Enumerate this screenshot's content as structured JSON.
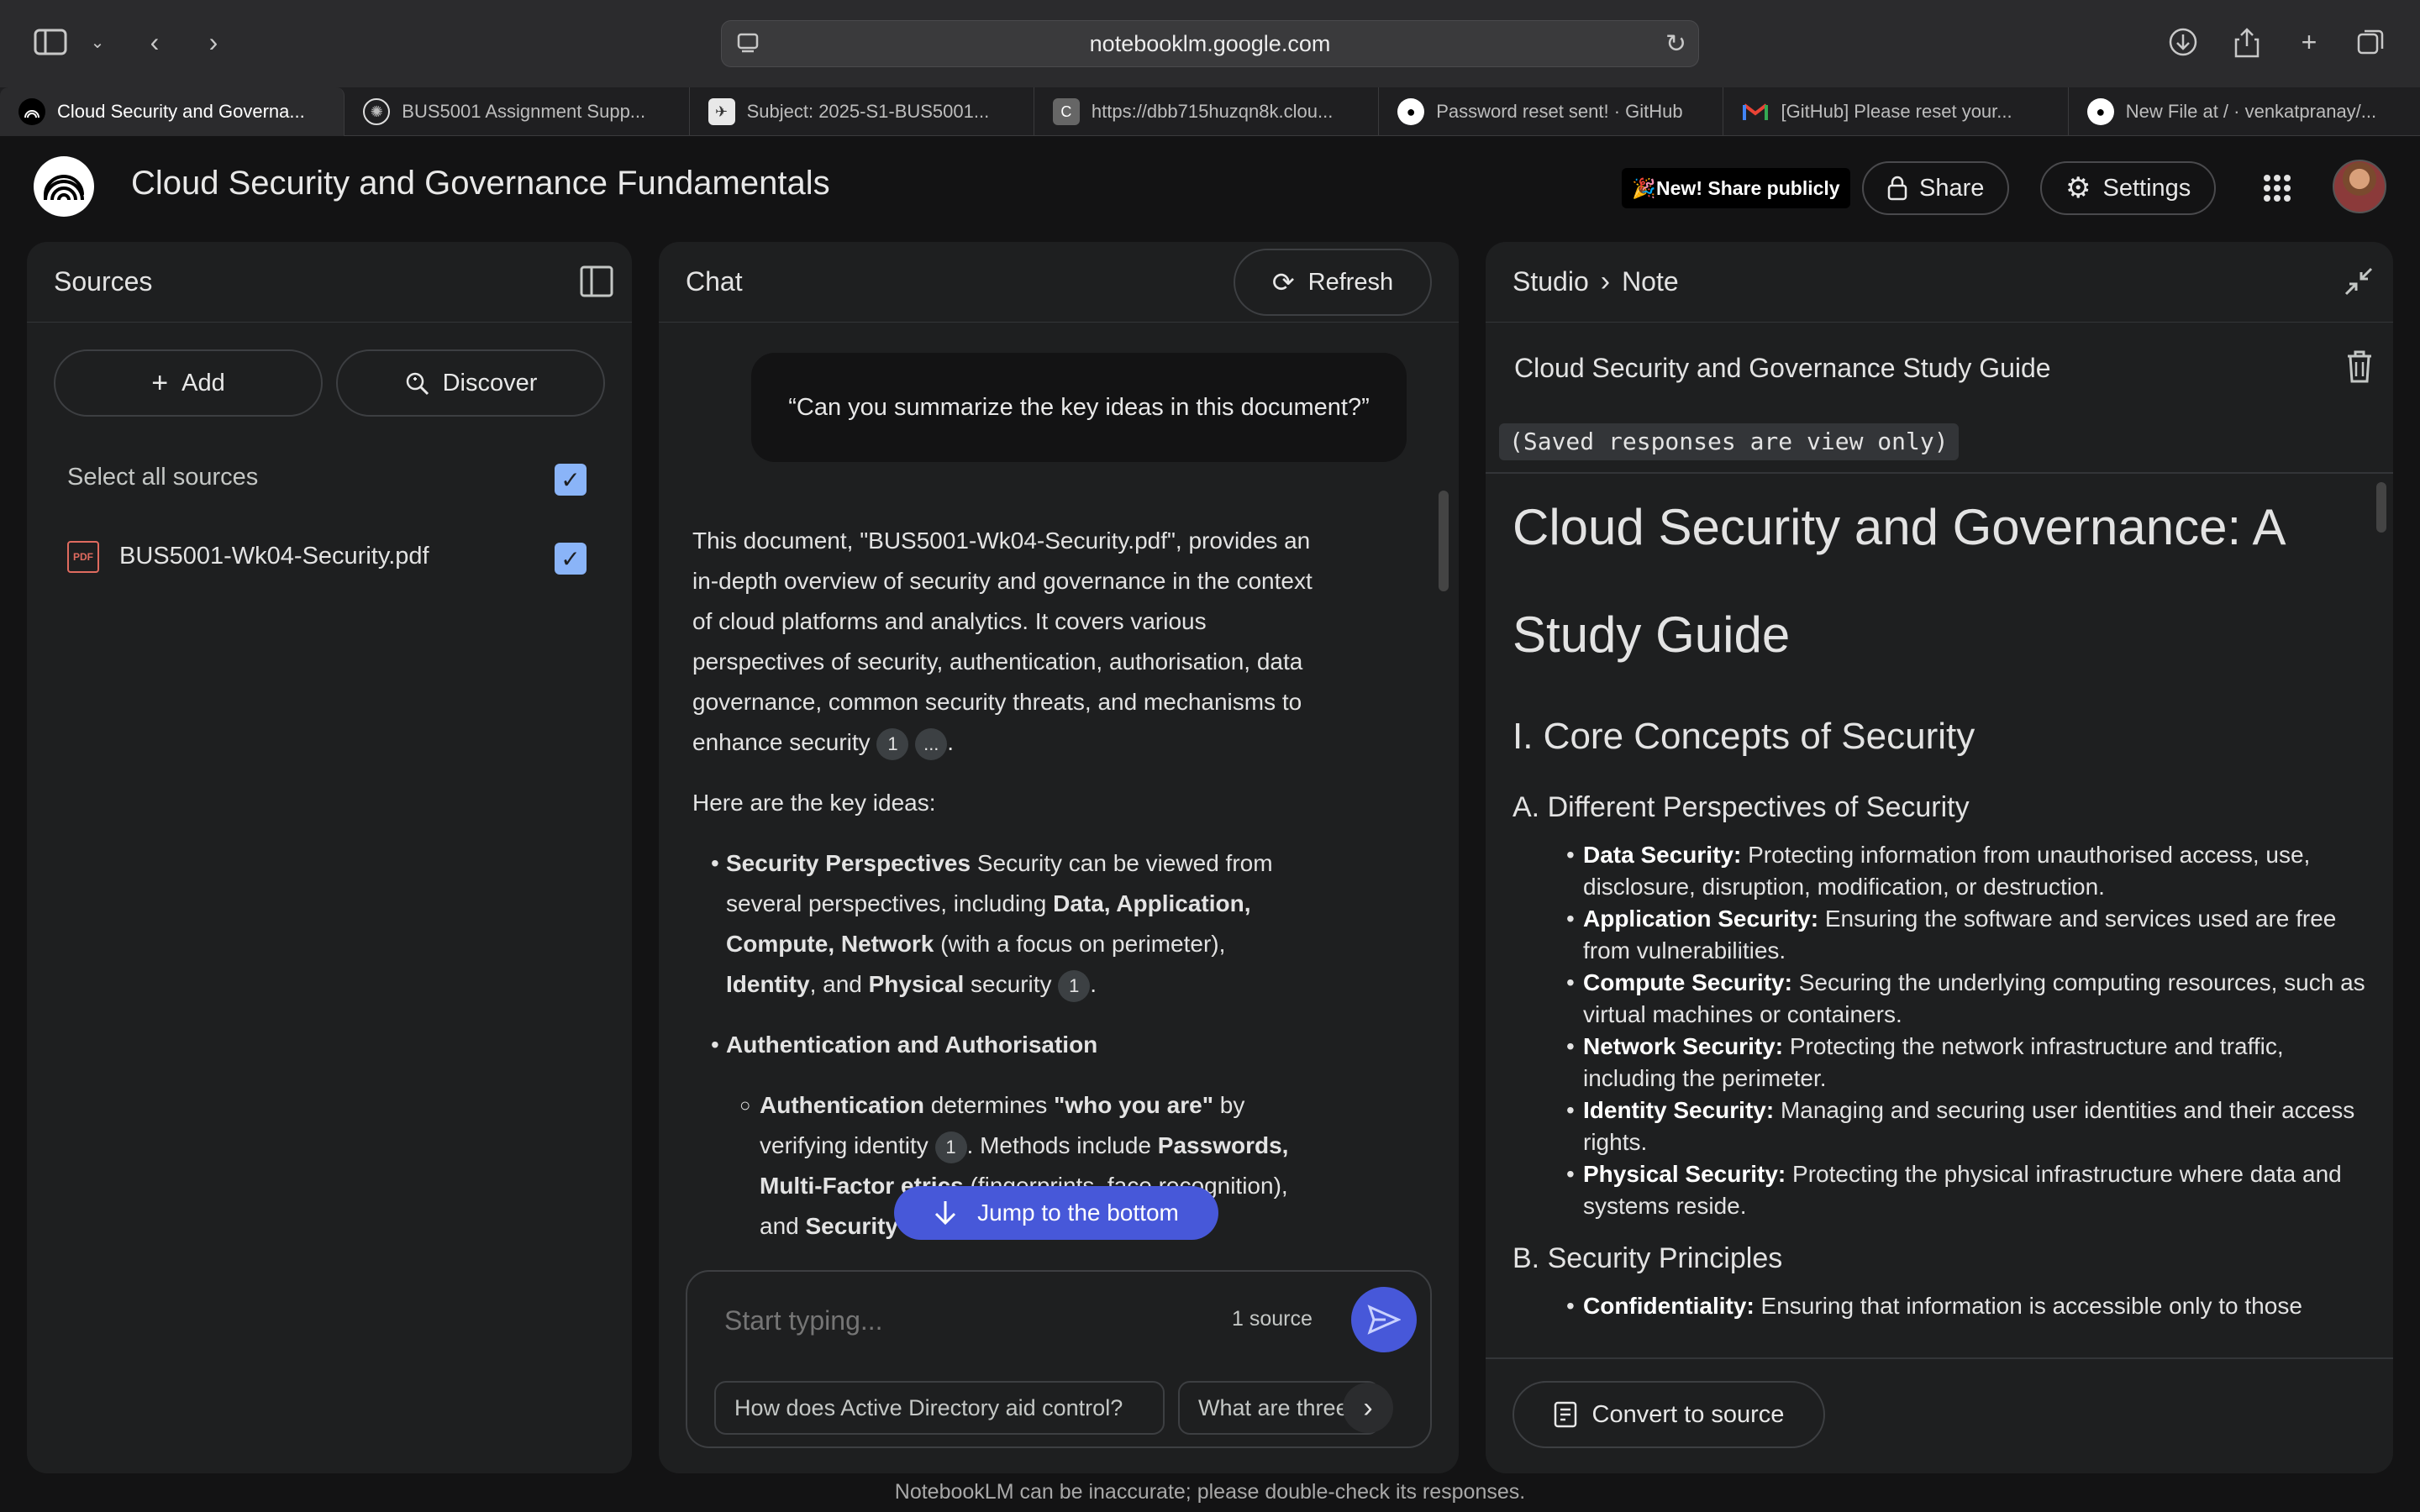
{
  "browser": {
    "url": "notebooklm.google.com",
    "tabs": [
      {
        "title": "Cloud Security and Governa...",
        "active": true,
        "fav": "notebooklm"
      },
      {
        "title": "BUS5001 Assignment Supp...",
        "fav": "chatgpt"
      },
      {
        "title": "Subject: 2025-S1-BUS5001...",
        "fav": "subject"
      },
      {
        "title": "https://dbb715huzqn8k.clou...",
        "fav": "c"
      },
      {
        "title": "Password reset sent! · GitHub",
        "fav": "github"
      },
      {
        "title": "[GitHub] Please reset your...",
        "fav": "gmail"
      },
      {
        "title": "New File at / · venkatpranay/...",
        "fav": "github"
      }
    ]
  },
  "header": {
    "notebook_title": "Cloud Security and Governance Fundamentals",
    "new_badge": "🎉New! Share publicly",
    "share_label": "Share",
    "settings_label": "Settings"
  },
  "sources": {
    "title": "Sources",
    "add_label": "Add",
    "discover_label": "Discover",
    "select_all_label": "Select all sources",
    "items": [
      {
        "name": "BUS5001-Wk04-Security.pdf",
        "checked": true
      }
    ]
  },
  "chat": {
    "title": "Chat",
    "refresh_label": "Refresh",
    "user_message": "“Can you summarize the key ideas in this document?”",
    "intro_parts": [
      "This document, \"BUS5001-Wk04-Security.pdf\", provides an in-depth overview of security and governance in the context of cloud platforms and analytics. It covers various perspectives of security, authentication, authorisation, data governance, common security threats, and mechanisms to enhance security",
      "1",
      "...",
      "."
    ],
    "key_ideas_label": "Here are the key ideas:",
    "bullet1": {
      "bold": "Security Perspectives",
      "text1": " Security can be viewed from several perspectives, including ",
      "bold2": "Data, Application, Compute, Network",
      "text2": " (with a focus on perimeter), ",
      "bold3": "Identity",
      "text3": ", and ",
      "bold4": "Physical",
      "text4": " security",
      "cite": "1",
      "end": "."
    },
    "bullet2_title": "Authentication and Authorisation",
    "sub1": {
      "bold": "Authentication",
      "text1": " determines ",
      "bold2": "\"who you are\"",
      "text2": " by verifying identity ",
      "cite": "1",
      "text3": ". Methods include ",
      "bold3": "Passwords, Multi-Factor",
      "text4": " ",
      "bold4": "etrics",
      "text5": " (fingerprints, face recognition), and ",
      "bold5": "Security"
    },
    "jump_label": "Jump to the bottom",
    "input_placeholder": "Start typing...",
    "source_count": "1 source",
    "suggestions": [
      "How does Active Directory aid control?",
      "What are three"
    ]
  },
  "studio": {
    "breadcrumb_root": "Studio",
    "breadcrumb_current": "Note",
    "note_title": "Cloud Security and Governance Study Guide",
    "saved_notice": "(Saved responses are view only)",
    "doc_title": "Cloud Security and Governance: A Study Guide",
    "section1": "I. Core Concepts of Security",
    "subsection_a": "A. Different Perspectives of Security",
    "perspectives": [
      {
        "term": "Data Security:",
        "desc": " Protecting information from unauthorised access, use, disclosure, disruption, modification, or destruction."
      },
      {
        "term": "Application Security:",
        "desc": " Ensuring the software and services used are free from vulnerabilities."
      },
      {
        "term": "Compute Security:",
        "desc": " Securing the underlying computing resources, such as virtual machines or containers."
      },
      {
        "term": "Network Security:",
        "desc": " Protecting the network infrastructure and traffic, including the perimeter."
      },
      {
        "term": "Identity Security:",
        "desc": " Managing and securing user identities and their access rights."
      },
      {
        "term": "Physical Security:",
        "desc": " Protecting the physical infrastructure where data and systems reside."
      }
    ],
    "subsection_b": "B. Security Principles",
    "principle_term": "Confidentiality:",
    "principle_desc": " Ensuring that information is accessible only to those",
    "convert_label": "Convert to source"
  },
  "footer_disclaimer": "NotebookLM can be inaccurate; please double-check its responses."
}
